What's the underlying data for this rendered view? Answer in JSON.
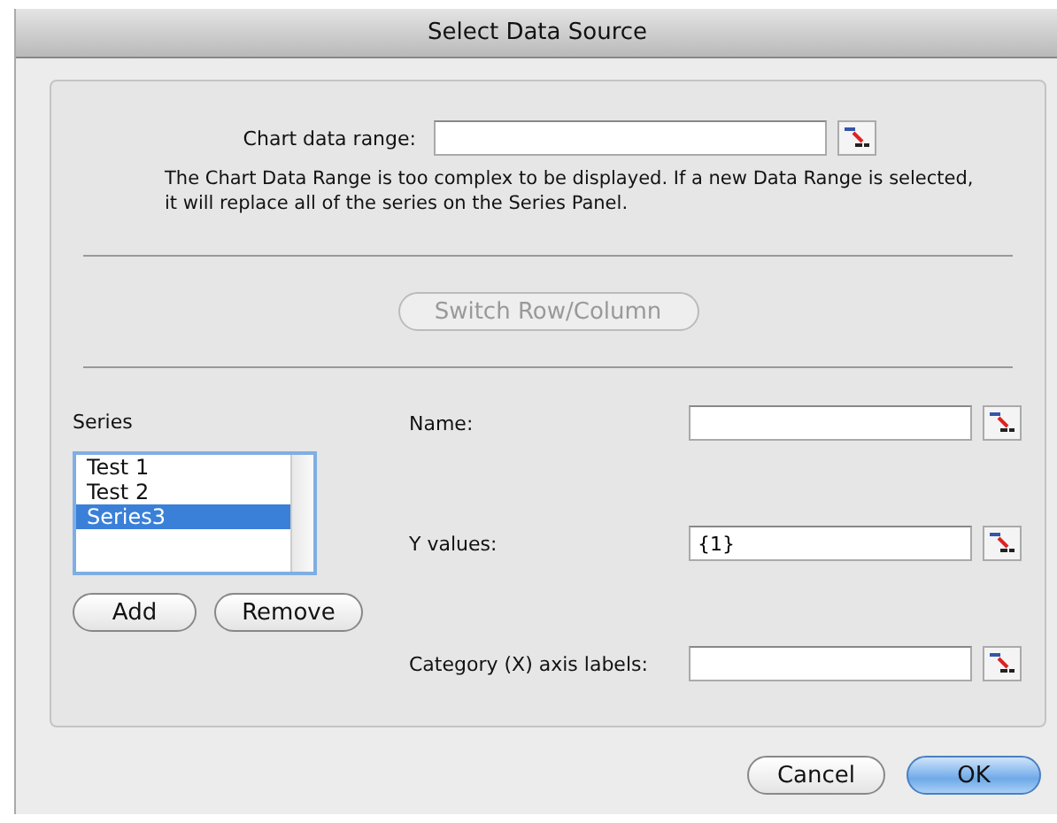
{
  "window": {
    "title": "Select Data Source"
  },
  "chart_data_range": {
    "label": "Chart data range:"
  },
  "message": "The Chart Data Range is too complex to be displayed. If a new Data Range is selected, it will replace all of the series on the Series Panel.",
  "switch_button": {
    "label": "Switch Row/Column",
    "disabled": true
  },
  "series": {
    "label": "Series",
    "items": [
      {
        "name": "Test 1",
        "selected": false
      },
      {
        "name": "Test 2",
        "selected": false
      },
      {
        "name": "Series3",
        "selected": true
      }
    ],
    "buttons": [
      "Add",
      "Remove"
    ]
  },
  "fields": [
    {
      "label": "Name:"
    },
    {
      "label": "Y values:",
      "value": "{1}"
    },
    {
      "label": "Category (X) axis labels:"
    }
  ],
  "buttons": [
    {
      "label": "Cancel",
      "default": false
    },
    {
      "label": "OK",
      "default": true
    }
  ]
}
